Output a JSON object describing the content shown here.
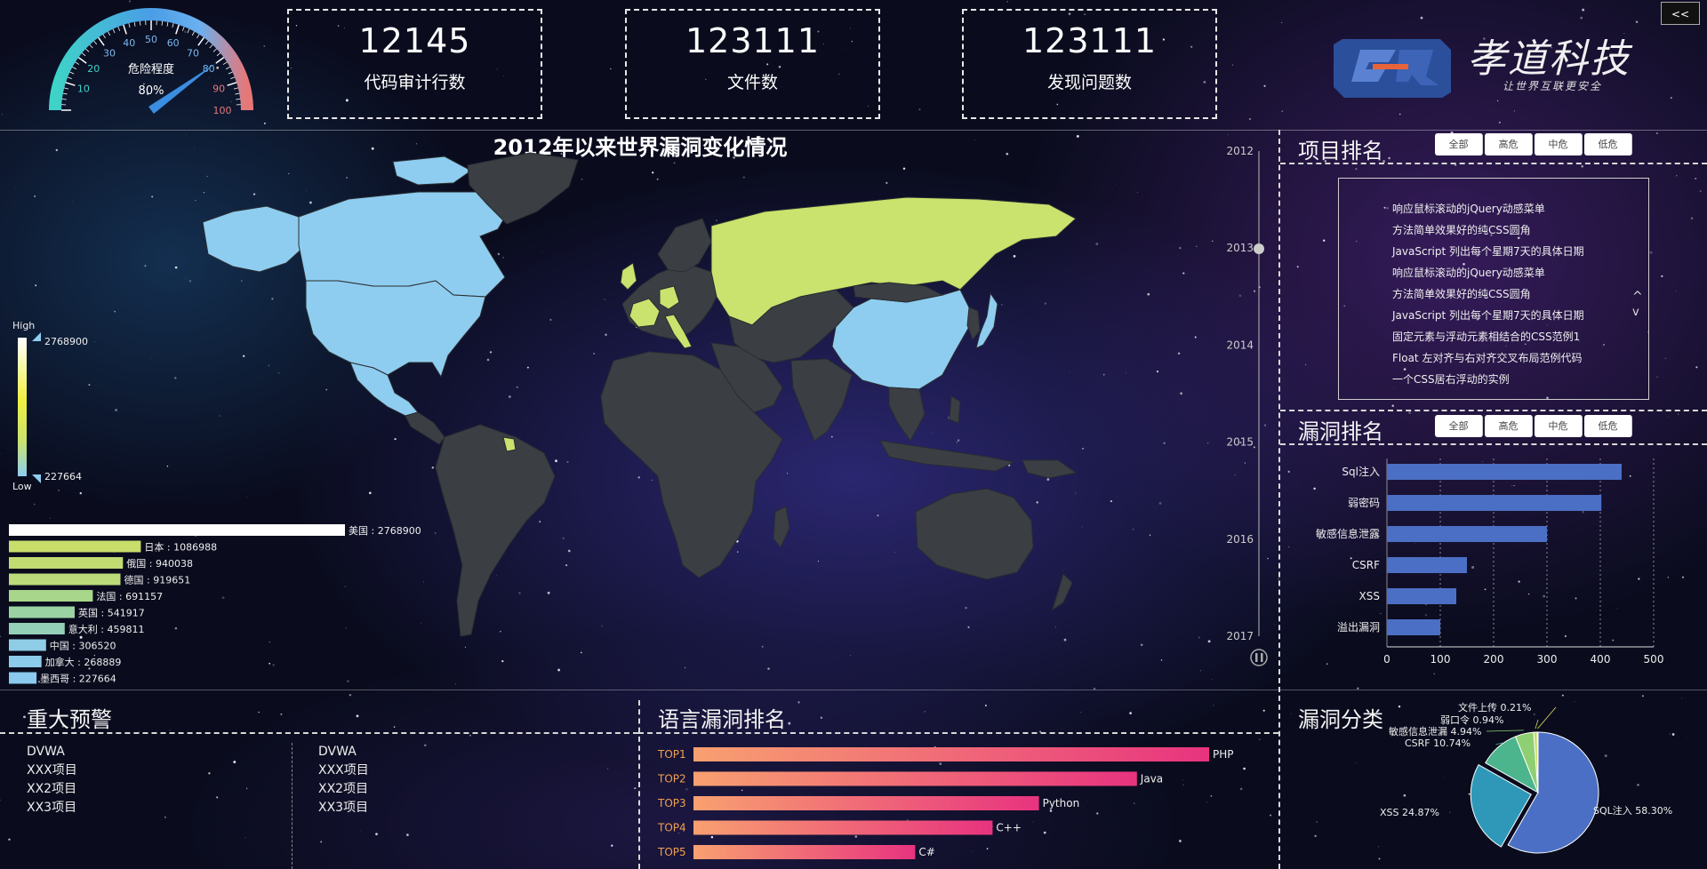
{
  "gauge": {
    "label": "危险程度",
    "value_text": "80%",
    "value": 80,
    "ticks": [
      "10",
      "20",
      "30",
      "40",
      "50",
      "60",
      "70",
      "80",
      "90",
      "100"
    ]
  },
  "kpis": [
    {
      "value": "12145",
      "label": "代码审计行数"
    },
    {
      "value": "123111",
      "label": "文件数"
    },
    {
      "value": "123111",
      "label": "发现问题数"
    }
  ],
  "logo": {
    "name": "孝道科技",
    "slogan": "让世界互联更安全"
  },
  "expand_label": "<<",
  "map_panel": {
    "title": "2012年以来世界漏洞变化情况",
    "visual_map": {
      "high_label": "High",
      "low_label": "Low",
      "max": "2768900",
      "min": "227664"
    },
    "timeline": [
      "2012",
      "2013",
      "2014",
      "2015",
      "2016",
      "2017"
    ],
    "highlighted_countries": [
      {
        "name": "美国",
        "color": "#8ecdf0"
      },
      {
        "name": "加拿大",
        "color": "#8ecdf0"
      },
      {
        "name": "中国",
        "color": "#8ecdf0"
      },
      {
        "name": "墨西哥",
        "color": "#8ecdf0"
      },
      {
        "name": "日本",
        "color": "#c9e36e"
      },
      {
        "name": "俄国",
        "color": "#c9e36e"
      }
    ]
  },
  "project_rank": {
    "title": "项目排名",
    "filters": [
      "全部",
      "高危",
      "中危",
      "低危"
    ],
    "items": [
      "响应鼠标滚动的jQuery动感菜单",
      "方法简单效果好的纯CSS圆角",
      "JavaScript 列出每个星期7天的具体日期",
      "响应鼠标滚动的jQuery动感菜单",
      "方法简单效果好的纯CSS圆角",
      "JavaScript 列出每个星期7天的具体日期",
      "固定元素与浮动元素相结合的CSS范例1",
      "Float 左对齐与右对齐交叉布局范例代码",
      "一个CSS居右浮动的实例"
    ],
    "scroll_up": "^",
    "scroll_down": "v"
  },
  "vuln_rank": {
    "title": "漏洞排名",
    "filters": [
      "全部",
      "高危",
      "中危",
      "低危"
    ]
  },
  "alerts": {
    "title": "重大预警",
    "left": [
      "DVWA",
      "XXX项目",
      "XX2项目",
      "XX3项目"
    ],
    "right": [
      "DVWA",
      "XXX项目",
      "XX2项目",
      "XX3项目"
    ]
  },
  "lang_rank": {
    "title": "语言漏洞排名"
  },
  "vuln_class": {
    "title": "漏洞分类"
  },
  "chart_data": [
    {
      "type": "bar",
      "orientation": "horizontal",
      "categories": [
        "美国",
        "日本",
        "俄国",
        "德国",
        "法国",
        "英国",
        "意大利",
        "中国",
        "加拿大",
        "墨西哥"
      ],
      "values": [
        2768900,
        1086988,
        940038,
        919651,
        691157,
        541917,
        459811,
        306520,
        268889,
        227664
      ],
      "colors": [
        "#ffffff",
        "#c9dd6a",
        "#c2dc72",
        "#bcdb7a",
        "#a8d68a",
        "#9bd2a4",
        "#94cfb8",
        "#8fcde6",
        "#8dcbea",
        "#8bc9ee"
      ]
    },
    {
      "type": "bar",
      "orientation": "horizontal",
      "categories": [
        "Sql注入",
        "弱密码",
        "敏感信息泄露",
        "CSRF",
        "XSS",
        "溢出漏洞"
      ],
      "values": [
        440,
        402,
        300,
        150,
        130,
        100
      ],
      "xlim": [
        0,
        500
      ],
      "xticks": [
        "0",
        "100",
        "200",
        "300",
        "400",
        "500"
      ],
      "color": "#4b6fc4"
    },
    {
      "type": "bar",
      "orientation": "horizontal",
      "categories": [
        "TOP1",
        "TOP2",
        "TOP3",
        "TOP4",
        "TOP5"
      ],
      "labels": [
        "PHP",
        "Java",
        "Python",
        "C++",
        "C#"
      ],
      "values": [
        100,
        86,
        67,
        58,
        43
      ],
      "gradient": [
        "#f8a070",
        "#e8337f"
      ]
    },
    {
      "type": "pie",
      "slices": [
        {
          "name": "SQL注入",
          "value": 58.3,
          "label": "SQL注入 58.30%",
          "color": "#4b6fc4"
        },
        {
          "name": "XSS",
          "value": 24.87,
          "label": "XSS 24.87%",
          "color": "#2f98b8"
        },
        {
          "name": "CSRF",
          "value": 10.74,
          "label": "CSRF 10.74%",
          "color": "#4cb58d"
        },
        {
          "name": "敏感信息泄漏",
          "value": 4.94,
          "label": "敏感信息泄漏 4.94%",
          "color": "#8fcf73"
        },
        {
          "name": "弱口令",
          "value": 0.94,
          "label": "弱口令 0.94%",
          "color": "#c6dc5a"
        },
        {
          "name": "文件上传",
          "value": 0.21,
          "label": "文件上传 0.21%",
          "color": "#e8e05a"
        }
      ]
    }
  ]
}
